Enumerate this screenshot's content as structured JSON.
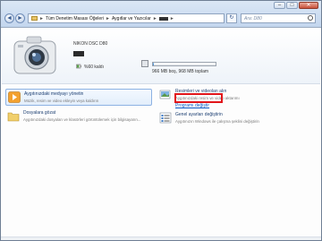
{
  "window": {
    "controls": {
      "minimize": "–",
      "maximize": "□",
      "close": "✕"
    }
  },
  "nav": {
    "back_icon": "arrow-left-icon",
    "forward_icon": "arrow-right-icon"
  },
  "address": {
    "breadcrumb": [
      "Tüm Denetim Masası Öğeleri",
      "Aygıtlar ve Yazıcılar"
    ],
    "separator": "►"
  },
  "search": {
    "placeholder": "Ara: D80"
  },
  "device": {
    "name": "NIKON DSC D80",
    "remaining": "%60 kaldı",
    "storage_text": "966 MB boş, 968 MB toplam",
    "storage_used_fraction": 0.02
  },
  "tasks": [
    {
      "title": "Aygıtınızdaki medyayı yönetin",
      "desc": "Müzik, resim ve video ekleyin veya kaldırın"
    },
    {
      "title": "Dosyalara gözat",
      "desc": "Aygıtınızdaki dosyaları ve klasörleri görüntülemek için bilgisayarın..."
    },
    {
      "title": "Resimleri ve videoları alın",
      "desc": "Aygıtınızdaki resim ve video aktarımı",
      "link": "Programı değiştir"
    },
    {
      "title": "Genel ayarları değiştirin",
      "desc": "Aygıtınızın Windows ile çalışma şeklini değiştirin"
    }
  ],
  "colors": {
    "link": "#0b57c2",
    "highlight_border": "#e2161b",
    "title_text": "#1c3f72"
  }
}
